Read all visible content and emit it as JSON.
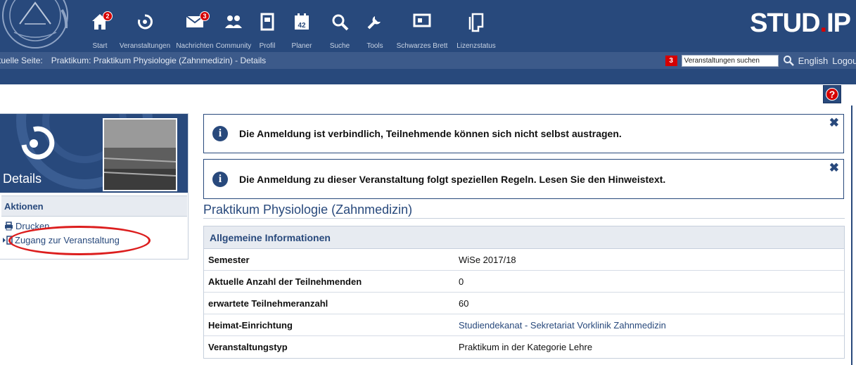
{
  "header": {
    "nav": [
      {
        "label": "Start",
        "icon": "home-icon",
        "badge": "2"
      },
      {
        "label": "Veranstaltungen",
        "icon": "courses-icon",
        "badge": ""
      },
      {
        "label": "Nachrichten",
        "icon": "mail-icon",
        "badge": "3"
      },
      {
        "label": "Community",
        "icon": "community-icon",
        "badge": ""
      },
      {
        "label": "Profil",
        "icon": "profile-icon",
        "badge": ""
      },
      {
        "label": "Planer",
        "icon": "calendar-icon",
        "badge": ""
      },
      {
        "label": "Suche",
        "icon": "search-icon",
        "badge": ""
      },
      {
        "label": "Tools",
        "icon": "tools-icon",
        "badge": ""
      },
      {
        "label": "Schwarzes Brett",
        "icon": "blackboard-icon",
        "badge": ""
      },
      {
        "label": "Lizenzstatus",
        "icon": "license-icon",
        "badge": ""
      }
    ],
    "brand": "STUD.IP",
    "calendar_day": "42"
  },
  "breadcrumb": {
    "label": "ktuelle Seite:",
    "value": "Praktikum: Praktikum Physiologie (Zahnmedizin) - Details"
  },
  "top_right": {
    "count": "3",
    "search_value": "Veranstaltungen suchen",
    "language": "English",
    "logout": "Logout"
  },
  "sidebar": {
    "title": "Details",
    "actions_heading": "Aktionen",
    "actions": [
      {
        "label": "Drucken",
        "icon": "print-icon"
      },
      {
        "label": "Zugang zur Veranstaltung",
        "icon": "access-icon"
      }
    ]
  },
  "messages": [
    {
      "text": "Die Anmeldung ist verbindlich, Teilnehmende können sich nicht selbst austragen."
    },
    {
      "text": "Die Anmeldung zu dieser Veranstaltung folgt speziellen Regeln. Lesen Sie den Hinweistext."
    }
  ],
  "course": {
    "title": "Praktikum Physiologie (Zahnmedizin)",
    "section_heading": "Allgemeine Informationen",
    "rows": [
      {
        "key": "Semester",
        "value": "WiSe 2017/18"
      },
      {
        "key": "Aktuelle Anzahl der Teilnehmenden",
        "value": "0"
      },
      {
        "key": "erwartete Teilnehmeranzahl",
        "value": "60"
      },
      {
        "key": "Heimat-Einrichtung",
        "value": "Studiendekanat - Sekretariat Vorklinik Zahnmedizin"
      },
      {
        "key": "Veranstaltungstyp",
        "value": "Praktikum in der Kategorie Lehre"
      }
    ]
  },
  "colors": {
    "primary": "#28497c",
    "accent": "#d60000",
    "annotation": "#dc1e1e"
  }
}
